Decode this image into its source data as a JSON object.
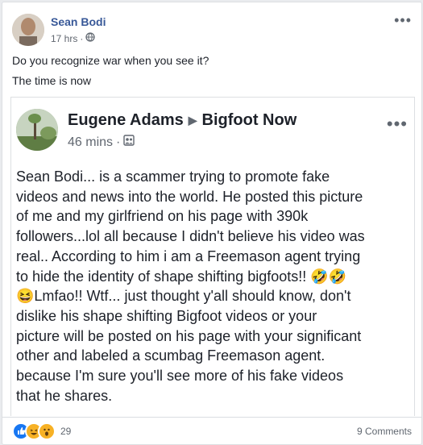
{
  "outer_post": {
    "author": "Sean Bodi",
    "timestamp": "17 hrs",
    "privacy_icon": "globe-icon",
    "line1": "Do you recognize war when you see it?",
    "line2": "The time is now"
  },
  "shared_post": {
    "author": "Eugene Adams",
    "group": "Bigfoot Now",
    "timestamp": "46 mins",
    "privacy_icon": "group-icon",
    "text": "Sean Bodi... is a scammer trying to promote fake\nvideos and news into the world. He posted this picture\nof me and my girlfriend on his page with 390k\nfollowers...lol all because I didn't believe his video was\nreal.. According to him i am a Freemason agent trying\nto hide the identity of shape shifting bigfoots!! 🤣🤣\n😆Lmfao!! Wtf... just thought y'all should know, don't\ndislike his shape shifting Bigfoot videos or your\npicture will be posted on his page with your significant\nother and labeled a scumbag Freemason agent.\nbecause I'm sure you'll see more of his fake videos\nthat he shares."
  },
  "footer": {
    "reaction_count": "29",
    "comments": "9 Comments",
    "reactions": [
      "like",
      "haha",
      "wow"
    ]
  },
  "colors": {
    "link_blue": "#385898",
    "like_blue": "#1877f2",
    "reaction_yellow": "#f7b125"
  }
}
